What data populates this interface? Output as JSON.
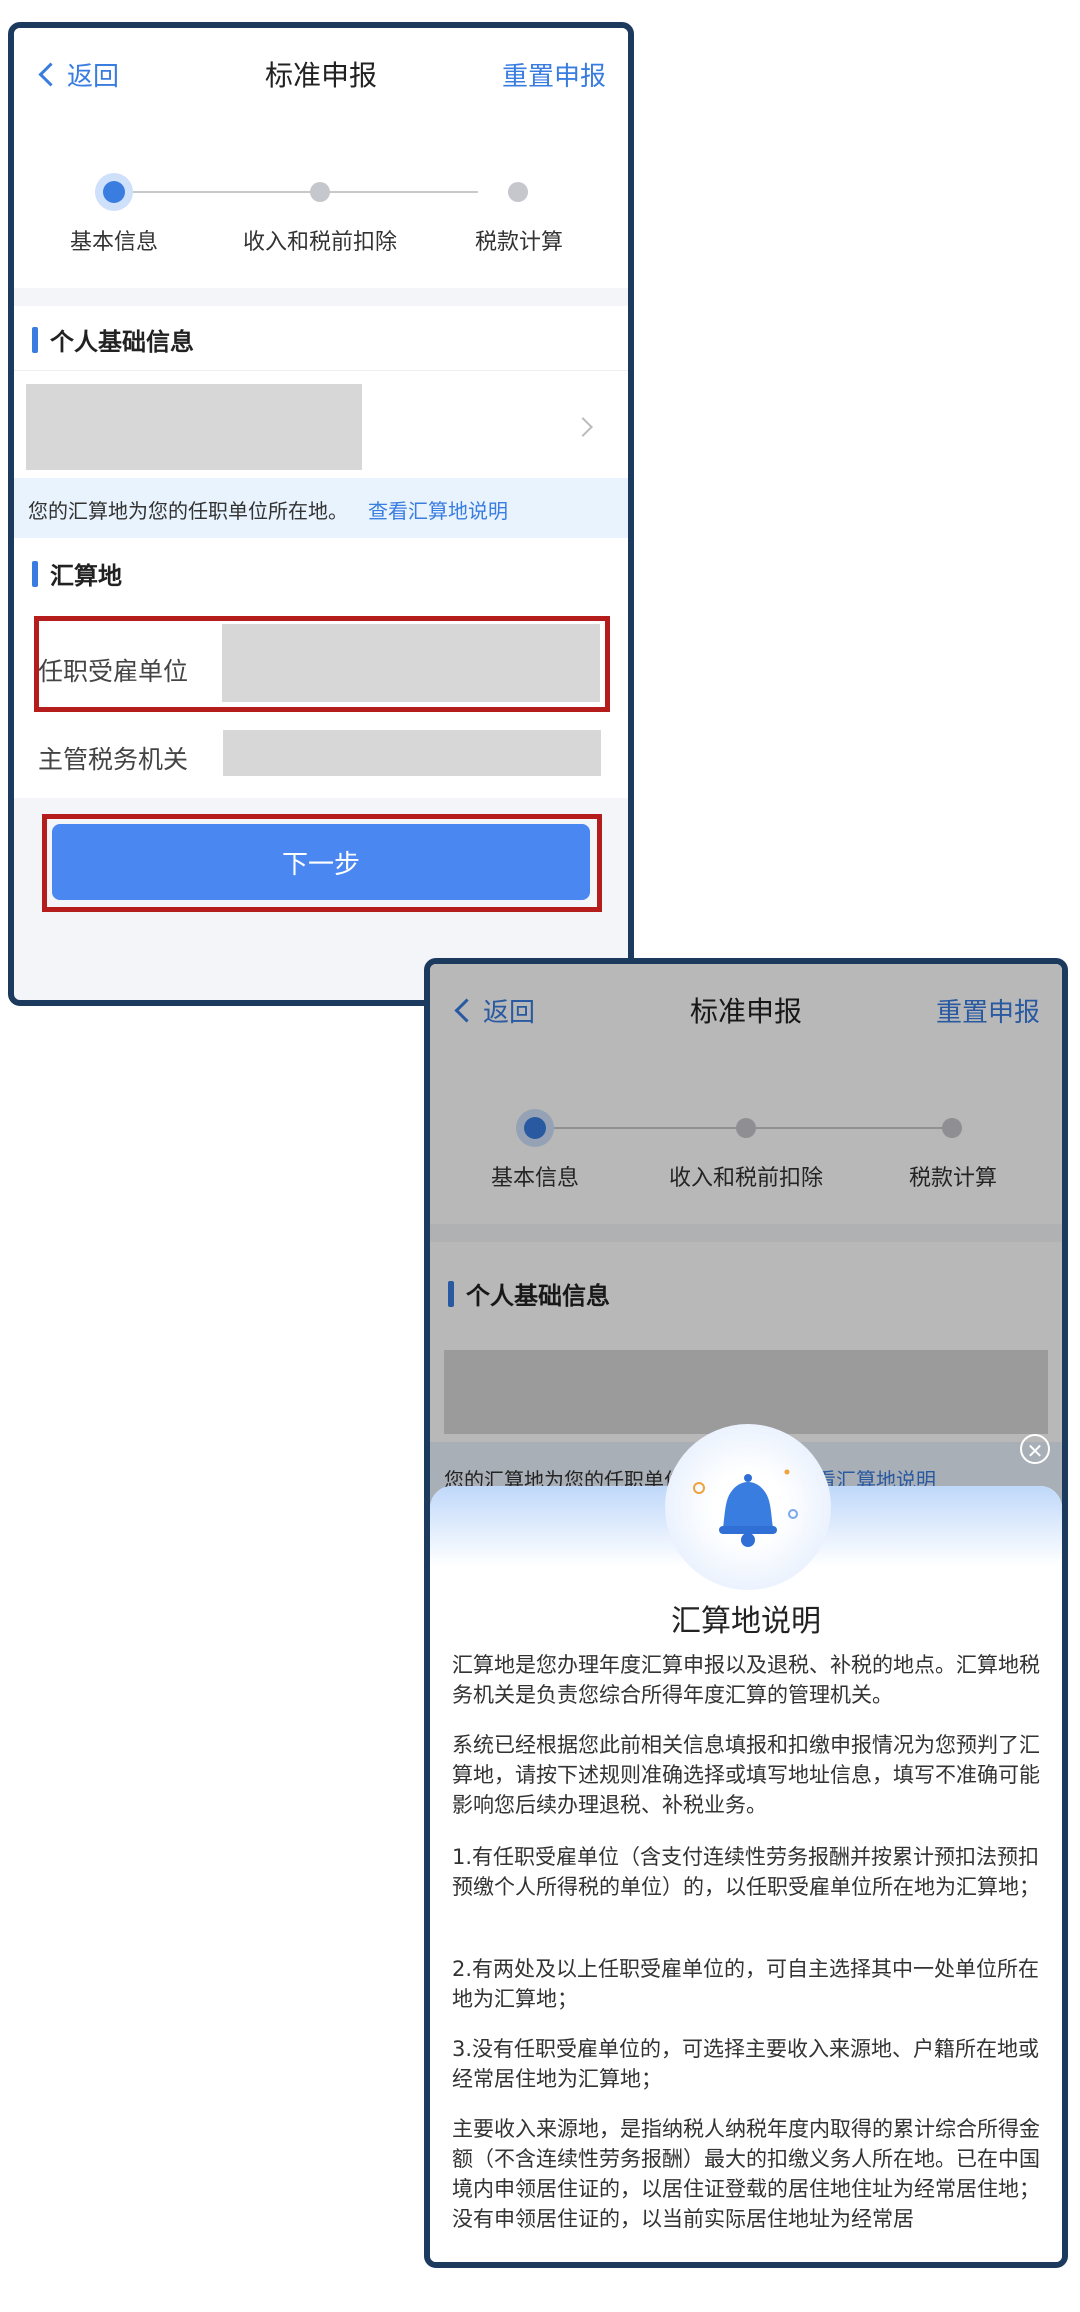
{
  "nav": {
    "back_label": "返回",
    "title": "标准申报",
    "reset_label": "重置申报"
  },
  "steps": [
    "基本信息",
    "收入和税前扣除",
    "税款计算"
  ],
  "personal_section": {
    "title": "个人基础信息"
  },
  "notice": {
    "text": "您的汇算地为您的任职单位所在地。",
    "link": "查看汇算地说明"
  },
  "location_section": {
    "title": "汇算地",
    "employer_label": "任职受雇单位",
    "tax_office_label": "主管税务机关"
  },
  "next_button": "下一步",
  "dialog": {
    "title": "汇算地说明",
    "paragraphs": [
      "汇算地是您办理年度汇算申报以及退税、补税的地点。汇算地税务机关是负责您综合所得年度汇算的管理机关。",
      "系统已经根据您此前相关信息填报和扣缴申报情况为您预判了汇算地，请按下述规则准确选择或填写地址信息，填写不准确可能影响您后续办理退税、补税业务。",
      "1.有任职受雇单位（含支付连续性劳务报酬并按累计预扣法预扣预缴个人所得税的单位）的，以任职受雇单位所在地为汇算地；",
      "2.有两处及以上任职受雇单位的，可自主选择其中一处单位所在地为汇算地；",
      "3.没有任职受雇单位的，可选择主要收入来源地、户籍所在地或经常居住地为汇算地；",
      "主要收入来源地，是指纳税人纳税年度内取得的累计综合所得金额（不含连续性劳务报酬）最大的扣缴义务人所在地。已在中国境内申领居住证的，以居住证登载的居住地住址为经常居住地；没有申领居住证的，以当前实际居住地址为经常居"
    ]
  },
  "colors": {
    "accent": "#3a7de0",
    "button": "#4b87f0",
    "highlight": "#b51c1c",
    "frame": "#1c3a5e"
  }
}
